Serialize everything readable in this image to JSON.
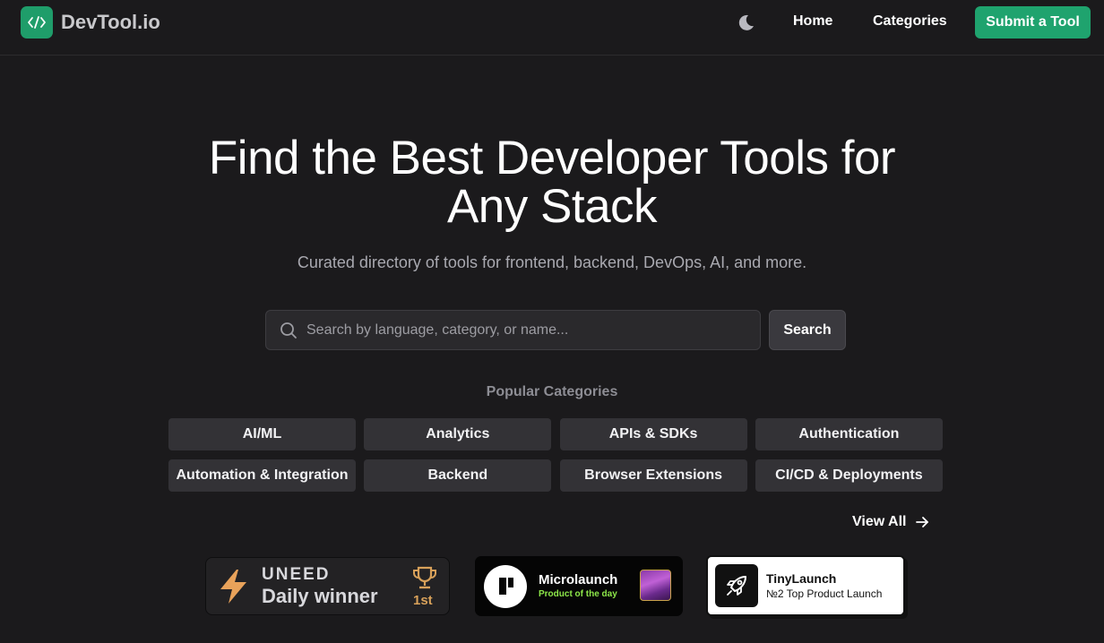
{
  "brand": {
    "name": "DevTool.io",
    "accent": "#1fa36e"
  },
  "nav": {
    "home": "Home",
    "categories": "Categories",
    "submit": "Submit a Tool",
    "theme_icon": "moon-icon"
  },
  "hero": {
    "title_line1": "Find the Best Developer Tools for",
    "title_line2": "Any Stack",
    "subtitle": "Curated directory of tools for frontend, backend, DevOps, AI, and more."
  },
  "search": {
    "placeholder": "Search by language, category, or name...",
    "value": "",
    "button": "Search"
  },
  "categories": {
    "title": "Popular Categories",
    "items": [
      "AI/ML",
      "Analytics",
      "APIs & SDKs",
      "Authentication",
      "Automation & Integration",
      "Backend",
      "Browser Extensions",
      "CI/CD & Deployments"
    ],
    "view_all": "View All"
  },
  "badges": {
    "uneed": {
      "brand": "UNEED",
      "label": "Daily winner",
      "rank": "1st"
    },
    "microlaunch": {
      "name": "Microlaunch",
      "sub": "Product of the day"
    },
    "tinylaunch": {
      "name": "TinyLaunch",
      "sub": "№2 Top Product Launch"
    }
  }
}
